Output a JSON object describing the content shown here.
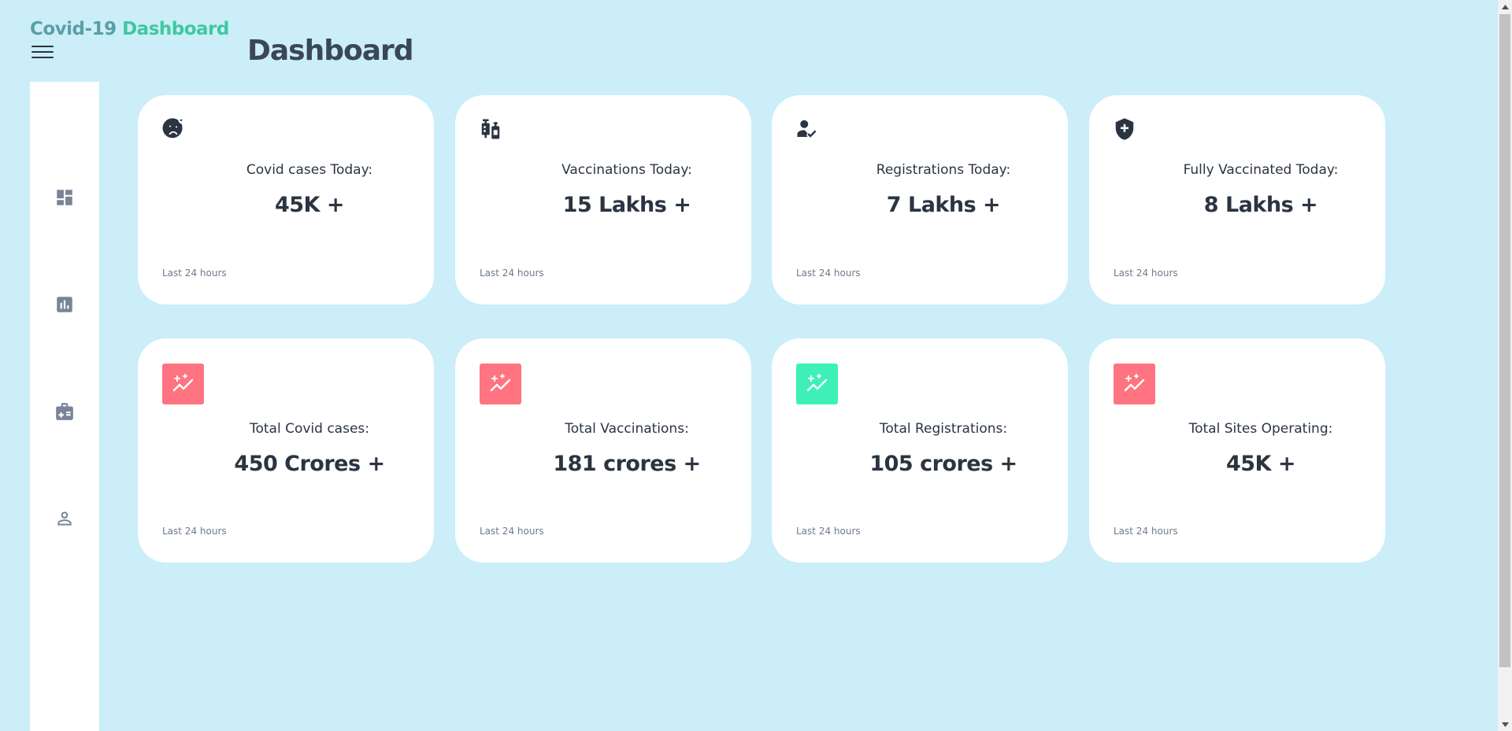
{
  "brand": {
    "part1": "Covid-19",
    "part2": "Dashboard"
  },
  "header": {
    "title": "Dashboard"
  },
  "sidebar": {
    "items": [
      {
        "name": "dashboard",
        "icon": "grid-icon"
      },
      {
        "name": "stats",
        "icon": "bar-chart-icon"
      },
      {
        "name": "medical",
        "icon": "medical-kit-icon"
      },
      {
        "name": "profile",
        "icon": "user-icon"
      }
    ]
  },
  "today_cards": [
    {
      "label": "Covid cases Today:",
      "value": "45K +",
      "footnote": "Last 24 hours",
      "icon": "sick-face-icon"
    },
    {
      "label": "Vaccinations Today:",
      "value": "15 Lakhs +",
      "footnote": "Last 24 hours",
      "icon": "vaccine-icon"
    },
    {
      "label": "Registrations Today:",
      "value": "7 Lakhs +",
      "footnote": "Last 24 hours",
      "icon": "user-check-icon"
    },
    {
      "label": "Fully Vaccinated Today:",
      "value": "8 Lakhs +",
      "footnote": "Last 24 hours",
      "icon": "shield-plus-icon"
    }
  ],
  "total_cards": [
    {
      "label": "Total Covid cases:",
      "value": "450 Crores +",
      "footnote": "Last 24 hours",
      "icon": "trend-sparkle-icon",
      "color": "#ff7480"
    },
    {
      "label": "Total Vaccinations:",
      "value": "181 crores +",
      "footnote": "Last 24 hours",
      "icon": "trend-sparkle-icon",
      "color": "#ff7480"
    },
    {
      "label": "Total Registrations:",
      "value": "105 crores +",
      "footnote": "Last 24 hours",
      "icon": "trend-sparkle-icon",
      "color": "#3ef0b8"
    },
    {
      "label": "Total Sites Operating:",
      "value": "45K +",
      "footnote": "Last 24 hours",
      "icon": "trend-sparkle-icon",
      "color": "#ff7480"
    }
  ]
}
